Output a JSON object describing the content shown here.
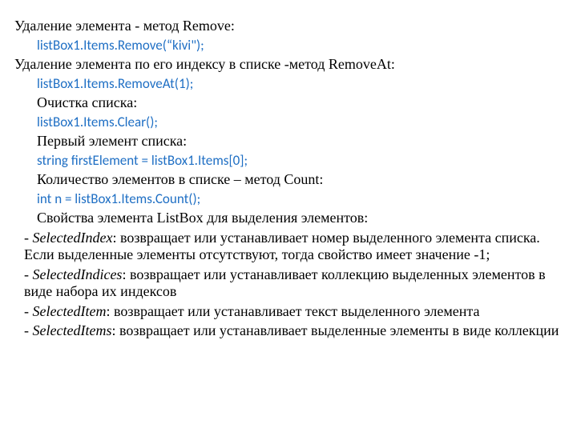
{
  "l1": "Удаление элемента - метод Remove:",
  "l2": "listBox1.Items.Remove(“kivi\");",
  "l3": "Удаление элемента по его индексу в списке -метод RemoveAt:",
  "l4": "listBox1.Items.RemoveAt(1);",
  "l5": "Очистка списка:",
  "l6": "listBox1.Items.Clear();",
  "l7": "Первый элемент списка:",
  "l8": "string firstElement = listBox1.Items[0];",
  "l9": "Количество элементов в списке – метод Count:",
  "l10": "int n = listBox1.Items.Count();",
  "l11": "Свойства элемента ListBox для выделения элементов:",
  "p1a": " - ",
  "p1b": "SelectedIndex",
  "p1c": ": возвращает или устанавливает номер выделенного элемента списка. Если выделенные элементы отсутствуют, тогда свойство имеет значение -1;",
  "p2a": " - ",
  "p2b": "SelectedIndices",
  "p2c": ": возвращает или устанавливает коллекцию выделенных элементов в виде набора их индексов",
  "p3a": " - ",
  "p3b": "SelectedItem",
  "p3c": ": возвращает или устанавливает текст выделенного элемента",
  "p4a": " - ",
  "p4b": "SelectedItems",
  "p4c": ": возвращает или устанавливает выделенные элементы в виде коллекции"
}
